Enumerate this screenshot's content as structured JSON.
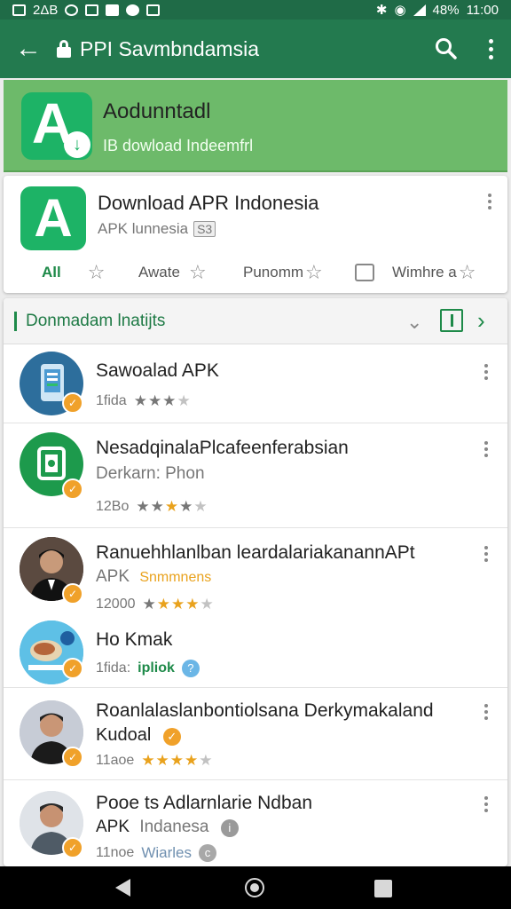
{
  "status_bar": {
    "left_text": "2ΔB",
    "battery": "48%",
    "time": "11:00"
  },
  "app_bar": {
    "title": "PPI Savmbndamsia"
  },
  "banner": {
    "title": "Aodunntadl",
    "subtitle": "IB dowload Indeemfrl"
  },
  "featured": {
    "title": "Download APR Indonesia",
    "subtitle": "APK lunnesia",
    "badge": "S3",
    "chips": [
      "All",
      "Awate",
      "Punomm",
      "Wimhre a"
    ]
  },
  "section": {
    "title": "Donmadam lnatijts"
  },
  "items": [
    {
      "title": "Sawoalad APK",
      "sub": "",
      "meta": "1fida",
      "stars": [
        1,
        1,
        1,
        0,
        0
      ]
    },
    {
      "title": "NesadqinalaPlcafeenferabsian",
      "sub": "Derkarn: Phon",
      "meta": "12Bo",
      "stars": [
        1,
        1,
        2,
        1,
        0
      ]
    },
    {
      "title": "Ranuehhlanlban leardalariakanannAPt",
      "sub": "APK",
      "sub_highlight": "Snmmnens",
      "meta": "12000",
      "stars": [
        1,
        2,
        2,
        2,
        0
      ]
    },
    {
      "title": "Ho Kmak",
      "sub": "",
      "meta": "1fida:",
      "meta_highlight": "ipliok",
      "stars": []
    },
    {
      "title": "Roanlalaslanbontiolsana Derkymakaland",
      "sub": "Kudoal",
      "meta": "11aoe",
      "stars": [
        2,
        2,
        2,
        2,
        0
      ]
    },
    {
      "title": "Pooe ts Adlarnlarie Ndban",
      "sub": "APK",
      "sub_highlight": "Indanesa",
      "meta": "11noe",
      "meta_highlight": "Wiarles",
      "stars": []
    }
  ],
  "colors": {
    "primary": "#237a4f",
    "banner": "#6dba6a",
    "accent_green": "#1db366",
    "badge_orange": "#f0a12a"
  }
}
